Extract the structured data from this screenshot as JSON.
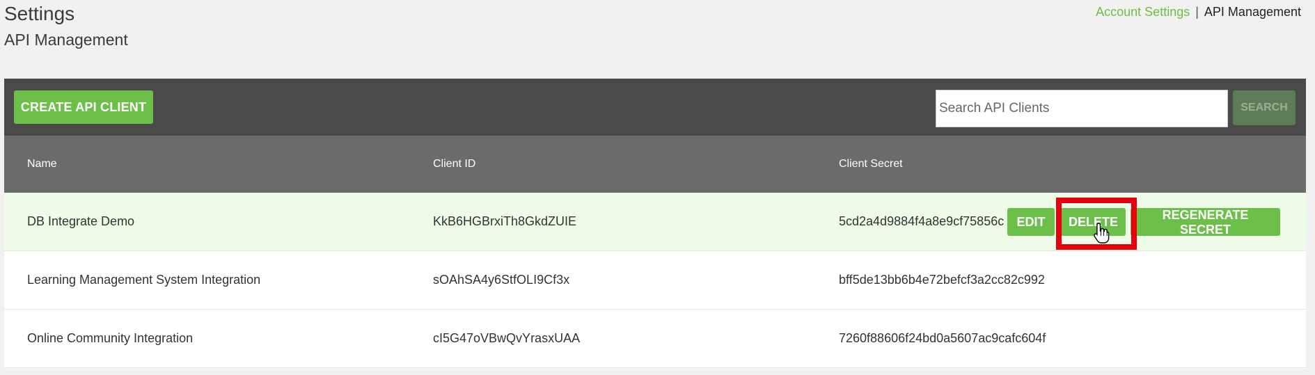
{
  "header": {
    "title": "Settings",
    "subtitle": "API Management"
  },
  "breadcrumb": {
    "link": "Account Settings",
    "separator": "|",
    "current": "API Management"
  },
  "toolbar": {
    "create_label": "CREATE API CLIENT",
    "search_placeholder": "Search API Clients",
    "search_value": "",
    "search_label": "SEARCH"
  },
  "table": {
    "columns": [
      "Name",
      "Client ID",
      "Client Secret"
    ],
    "rows": [
      {
        "name": "DB Integrate Demo",
        "client_id": "KkB6HGBrxiTh8GkdZUIE",
        "client_secret": "5cd2a4d9884f4a8e9cf75856c"
      },
      {
        "name": "Learning Management System Integration",
        "client_id": "sOAhSA4y6StfOLI9Cf3x",
        "client_secret": "bff5de13bb6b4e72befcf3a2cc82c992"
      },
      {
        "name": "Online Community Integration",
        "client_id": "cI5G47oVBwQvYrasxUAA",
        "client_secret": "7260f88606f24bd0a5607ac9cafc604f"
      }
    ],
    "row_actions": {
      "edit_label": "EDIT",
      "delete_label": "DELETE",
      "regenerate_label": "REGENERATE SECRET"
    }
  },
  "colors": {
    "accent": "#6cc04a",
    "toolbar_bg": "#4a4a4a",
    "header_bg": "#6b6b6b",
    "highlight_row": "#eefbe8",
    "annotation": "#e8000d"
  }
}
